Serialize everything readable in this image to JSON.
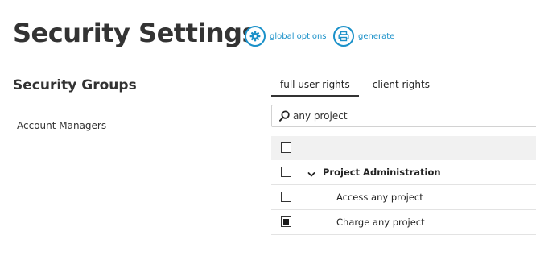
{
  "page": {
    "title": "Security Settings",
    "actions": [
      {
        "label": "global options",
        "icon": "gear-icon"
      },
      {
        "label": "generate",
        "icon": "printer-icon"
      }
    ]
  },
  "colors": {
    "accent": "#1b91c9",
    "text": "#333333",
    "header_bg": "#f1f1f1"
  },
  "groups": {
    "title": "Security Groups",
    "items": [
      "Account Managers"
    ]
  },
  "tabs": [
    {
      "label": "full user rights",
      "active": true
    },
    {
      "label": "client rights",
      "active": false
    }
  ],
  "search": {
    "value": "any project",
    "icon": "search-icon"
  },
  "rights_table": {
    "header_checked": false,
    "group": {
      "label": "Project Administration",
      "checked": false,
      "expanded": true
    },
    "rows": [
      {
        "label": "Access any project",
        "checked": false
      },
      {
        "label": "Charge any project",
        "checked": true
      }
    ]
  }
}
